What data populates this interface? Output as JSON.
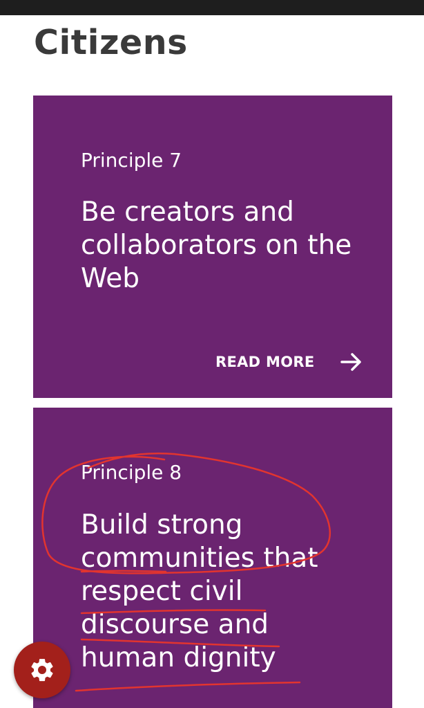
{
  "page": {
    "title": "Citizens"
  },
  "cards": [
    {
      "kicker": "Principle 7",
      "heading": "Be creators and collaborators on the Web",
      "read_more_label": "READ MORE",
      "icon": "arrow-right-icon"
    },
    {
      "kicker": "Principle 8",
      "heading": "Build strong communities that respect civil discourse and human dignity"
    }
  ],
  "settings_button": {
    "icon": "gear-icon"
  },
  "colors": {
    "card_background": "#6b2470",
    "title_text": "#3a3a3a",
    "status_bar": "#1e1e1e",
    "fab_background": "#a3201b",
    "annotation_ink": "#e2342f"
  }
}
